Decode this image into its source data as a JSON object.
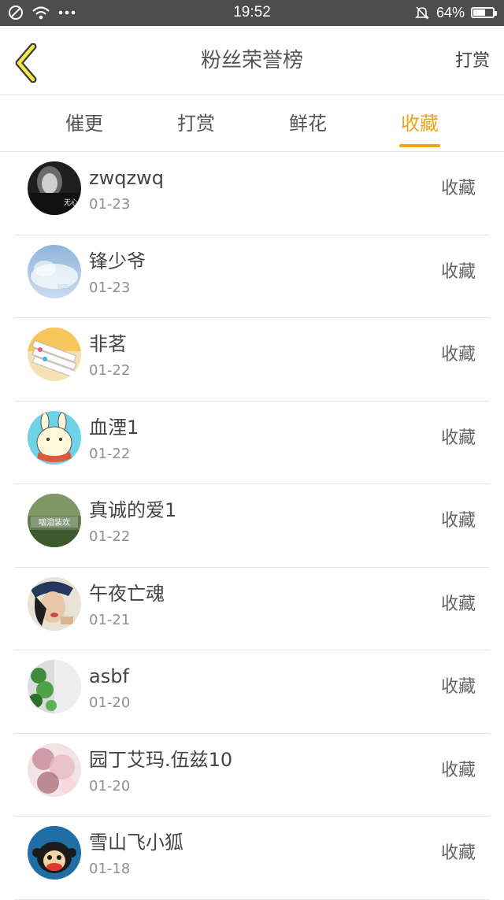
{
  "status_bar": {
    "time": "19:52",
    "battery": "64%",
    "battery_level": 0.64
  },
  "header": {
    "title": "粉丝荣誉榜",
    "action": "打赏"
  },
  "tabs": [
    {
      "label": "催更",
      "active": false
    },
    {
      "label": "打赏",
      "active": false
    },
    {
      "label": "鲜花",
      "active": false
    },
    {
      "label": "收藏",
      "active": true
    }
  ],
  "list": [
    {
      "name": "zwqzwq",
      "date": "01-23",
      "type": "收藏",
      "avatar_overlay": "无心"
    },
    {
      "name": "锋少爷",
      "date": "01-23",
      "type": "收藏"
    },
    {
      "name": "非茗",
      "date": "01-22",
      "type": "收藏"
    },
    {
      "name": "血湮1",
      "date": "01-22",
      "type": "收藏"
    },
    {
      "name": "真诚的爱1",
      "date": "01-22",
      "type": "收藏",
      "avatar_overlay": "咽泪装欢"
    },
    {
      "name": "午夜亡魂",
      "date": "01-21",
      "type": "收藏"
    },
    {
      "name": "asbf",
      "date": "01-20",
      "type": "收藏"
    },
    {
      "name": "园丁艾玛.伍兹10",
      "date": "01-20",
      "type": "收藏"
    },
    {
      "name": "雪山飞小狐",
      "date": "01-18",
      "type": "收藏"
    }
  ],
  "colors": {
    "accent": "#f1a31b",
    "status_bar": "#4d4d4d"
  }
}
